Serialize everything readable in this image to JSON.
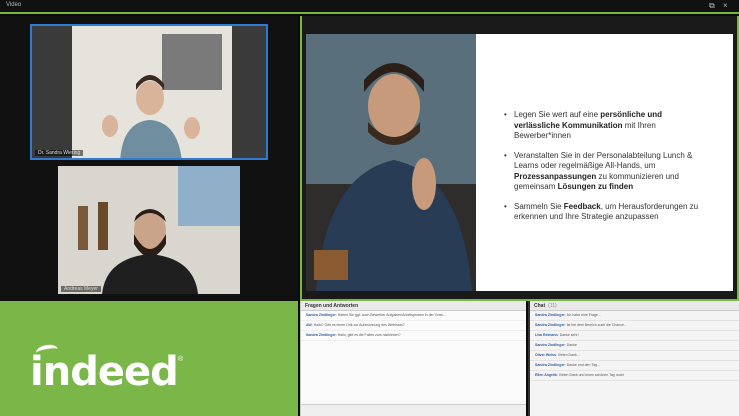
{
  "window": {
    "title": "Video",
    "restore_glyph": "⧉",
    "close_glyph": "×"
  },
  "participants": [
    {
      "name": "Dr. Sandra Wiering"
    },
    {
      "name": "Andreas Meyer"
    }
  ],
  "slide": {
    "bullets": [
      {
        "pre": "Legen Sie wert auf eine ",
        "bold": "persönliche und verlässliche Kommunikation",
        "post": " mit Ihren Bewerber*innen"
      },
      {
        "pre": "Veranstalten Sie in der Personalabteilung Lunch & Learns oder regelmäßige All-Hands, um ",
        "bold": "Prozessanpassungen",
        "post": " zu kommunizieren und gemeinsam ",
        "bold2": "Lösungen zu finden"
      },
      {
        "pre": "Sammeln Sie ",
        "bold": "Feedback",
        "post": ", um Herausforderungen zu erkennen und Ihre Strategie anzupassen"
      }
    ]
  },
  "brand": {
    "logo_text": "indeed",
    "reg_mark": "®"
  },
  "qa": {
    "header": "Fragen und Antworten",
    "items": [
      {
        "who": "Sandra Zindlinger",
        "text": ": Haben Sie ggf. auch Bewerber Aufgaben/Arbeitsproben in der Vorst..."
      },
      {
        "who": "AW",
        "text": ": Hallo? Gibt es einen Link zur Aufzeichnung des Webinars?"
      },
      {
        "who": "Sandra Zindlinger",
        "text": ": Hallo, gibt es die Folien zum nachlesen?"
      }
    ]
  },
  "chat": {
    "header": "Chat",
    "count": "(11)",
    "items": [
      {
        "who": "Sandra Zindlinger",
        "text": ": Ich habe eine Frage..."
      },
      {
        "who": "Sandra Zindlinger",
        "text": ": Ist bei dem Bereich auch die Chance..."
      },
      {
        "who": "Lisa Reimann",
        "text": ": Danke sehr!"
      },
      {
        "who": "Sandra Zindlinger",
        "text": ": Danke"
      },
      {
        "who": "Oliver Weiss",
        "text": ": Vielen Dank..."
      },
      {
        "who": "Sandra Zindlinger",
        "text": ": Danke und den Tag..."
      },
      {
        "who": "Ellen Angelik",
        "text": ": Vielen Dank und einen schönen Tag noch!"
      }
    ]
  },
  "colors": {
    "brand_green": "#7ab648",
    "active_speaker_border": "#2f7bd1"
  }
}
